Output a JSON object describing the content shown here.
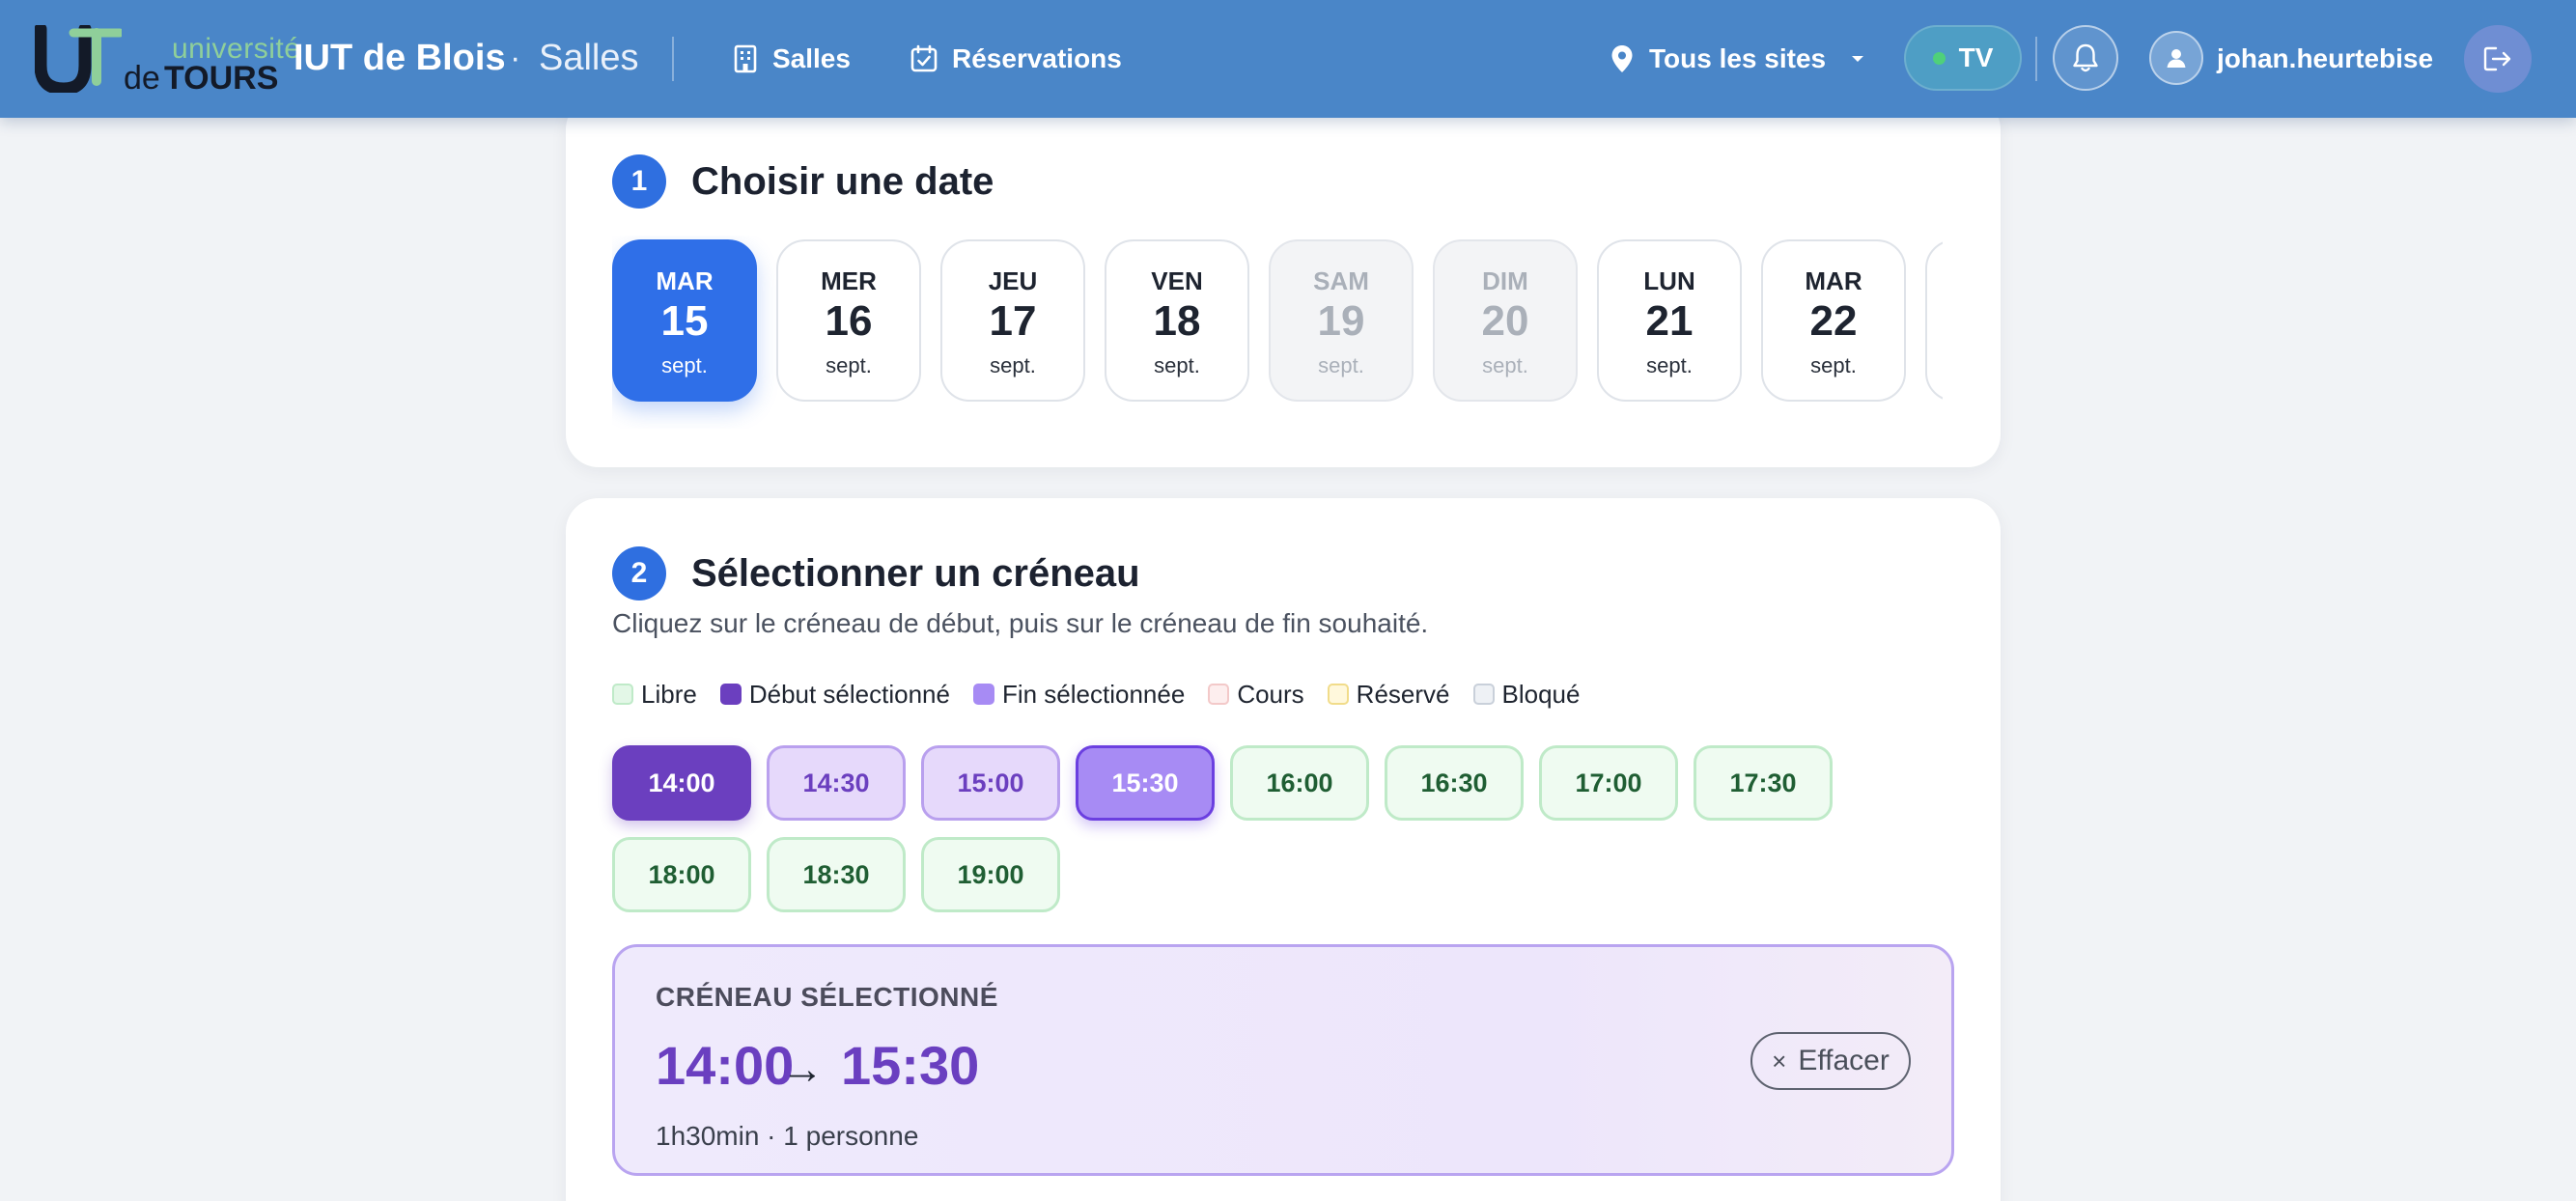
{
  "header": {
    "logo_small": "université",
    "logo_de": "de",
    "logo_tours": "TOURS",
    "brand": "IUT de Blois",
    "brand_sep": "·",
    "brand_sub": "Salles",
    "nav": [
      {
        "label": "Salles",
        "icon": "building-icon"
      },
      {
        "label": "Réservations",
        "icon": "calendar-check-icon"
      }
    ],
    "site_select": "Tous les sites",
    "tv_label": "TV",
    "username": "johan.heurtebise"
  },
  "step1": {
    "number": "1",
    "title": "Choisir une date",
    "dates": [
      {
        "dow": "MAR",
        "day": "15",
        "mon": "sept.",
        "state": "active"
      },
      {
        "dow": "MER",
        "day": "16",
        "mon": "sept.",
        "state": "normal"
      },
      {
        "dow": "JEU",
        "day": "17",
        "mon": "sept.",
        "state": "normal"
      },
      {
        "dow": "VEN",
        "day": "18",
        "mon": "sept.",
        "state": "normal"
      },
      {
        "dow": "SAM",
        "day": "19",
        "mon": "sept.",
        "state": "weekend"
      },
      {
        "dow": "DIM",
        "day": "20",
        "mon": "sept.",
        "state": "weekend"
      },
      {
        "dow": "LUN",
        "day": "21",
        "mon": "sept.",
        "state": "normal"
      },
      {
        "dow": "MAR",
        "day": "22",
        "mon": "sept.",
        "state": "normal"
      }
    ]
  },
  "step2": {
    "number": "2",
    "title": "Sélectionner un créneau",
    "helper": "Cliquez sur le créneau de début, puis sur le créneau de fin souhaité.",
    "legend": [
      {
        "label": "Libre",
        "color": "#e3f7e7",
        "border": "#bfeac8"
      },
      {
        "label": "Début sélectionné",
        "color": "#6b3fbf",
        "border": "#6b3fbf"
      },
      {
        "label": "Fin sélectionnée",
        "color": "#a78bf4",
        "border": "#a78bf4"
      },
      {
        "label": "Cours",
        "color": "#fdeeee",
        "border": "#f3c9c9"
      },
      {
        "label": "Réservé",
        "color": "#fff8dc",
        "border": "#f1dc8a"
      },
      {
        "label": "Bloqué",
        "color": "#eef1f5",
        "border": "#c9d0da"
      }
    ],
    "slots": [
      {
        "time": "14:00",
        "state": "start"
      },
      {
        "time": "14:30",
        "state": "range"
      },
      {
        "time": "15:00",
        "state": "range"
      },
      {
        "time": "15:30",
        "state": "end"
      },
      {
        "time": "16:00",
        "state": "free"
      },
      {
        "time": "16:30",
        "state": "free"
      },
      {
        "time": "17:00",
        "state": "free"
      },
      {
        "time": "17:30",
        "state": "free"
      },
      {
        "time": "18:00",
        "state": "free"
      },
      {
        "time": "18:30",
        "state": "free"
      },
      {
        "time": "19:00",
        "state": "free"
      }
    ],
    "summary": {
      "label": "CRÉNEAU SÉLECTIONNÉ",
      "start": "14:00",
      "arrow": "→",
      "end": "15:30",
      "meta": "1h30min · 1 personne",
      "clear_icon": "×",
      "clear_label": "Effacer"
    }
  },
  "colors": {
    "header": "#4a86c8",
    "accent_blue": "#2f6fe8",
    "purple": "#6b3fbf",
    "free_green": "#1f5e33"
  }
}
